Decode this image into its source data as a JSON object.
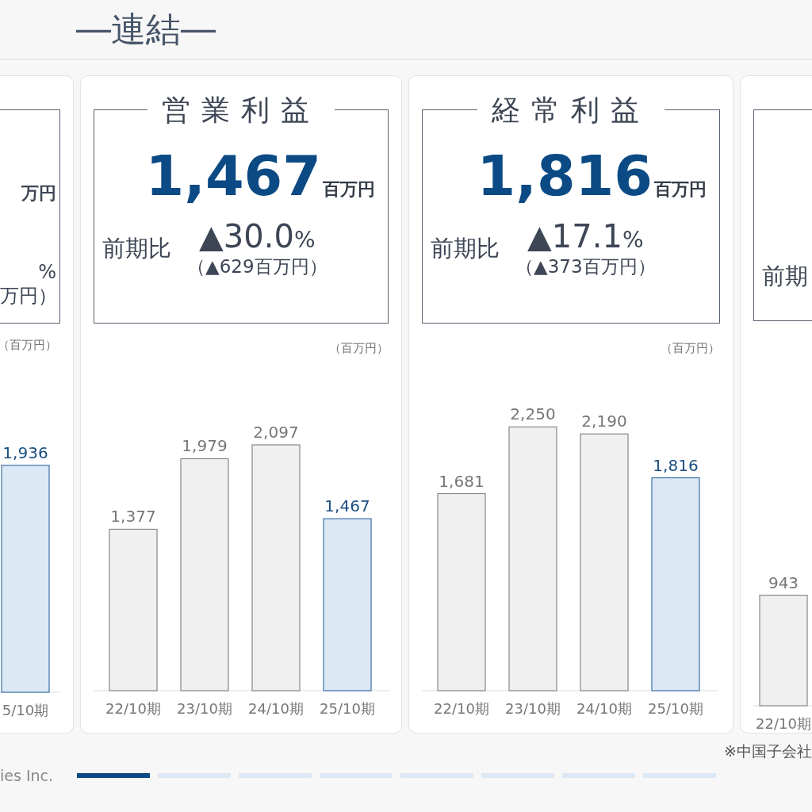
{
  "header": {
    "title": "―連結―"
  },
  "cards": [
    {
      "kind": "partial_left",
      "unit_fragment": "万円",
      "rate_fragment": "%",
      "amount_fragment": "万円）",
      "chart_unit": "（百万円）",
      "bars": [
        {
          "current": true
        }
      ],
      "chart_data": {
        "type": "bar",
        "categories": [
          "5/10期"
        ],
        "values": [
          1936
        ],
        "value_labels": [
          "1,936"
        ]
      }
    },
    {
      "kind": "full",
      "title": "営業利益",
      "value": "1,467",
      "unit": "百万円",
      "change_label": "前期比",
      "change_rate": "▲30.0",
      "change_rate_unit": "%",
      "change_amount": "（▲629百万円）",
      "chart_unit": "（百万円）",
      "bars": [
        {
          "current": false
        },
        {
          "current": false
        },
        {
          "current": false
        },
        {
          "current": true
        }
      ],
      "chart_data": {
        "type": "bar",
        "categories": [
          "22/10期",
          "23/10期",
          "24/10期",
          "25/10期"
        ],
        "values": [
          1377,
          1979,
          2097,
          1467
        ],
        "value_labels": [
          "1,377",
          "1,979",
          "2,097",
          "1,467"
        ]
      }
    },
    {
      "kind": "full",
      "title": "経常利益",
      "value": "1,816",
      "unit": "百万円",
      "change_label": "前期比",
      "change_rate": "▲17.1",
      "change_rate_unit": "%",
      "change_amount": "（▲373百万円）",
      "chart_unit": "（百万円）",
      "bars": [
        {
          "current": false
        },
        {
          "current": false
        },
        {
          "current": false
        },
        {
          "current": true
        }
      ],
      "chart_data": {
        "type": "bar",
        "categories": [
          "22/10期",
          "23/10期",
          "24/10期",
          "25/10期"
        ],
        "values": [
          1681,
          2250,
          2190,
          1816
        ],
        "value_labels": [
          "1,681",
          "2,250",
          "2,190",
          "1,816"
        ]
      }
    },
    {
      "kind": "partial_right",
      "change_label": "前期",
      "bars": [
        {
          "current": false
        }
      ],
      "chart_data": {
        "type": "bar",
        "categories": [
          "22/10期"
        ],
        "values": [
          943
        ],
        "value_labels": [
          "943"
        ]
      }
    }
  ],
  "footer": {
    "note": "※中国子会社",
    "company": "ies Inc.",
    "pages": [
      {
        "selected": true
      },
      {
        "selected": false
      },
      {
        "selected": false
      },
      {
        "selected": false
      },
      {
        "selected": false
      },
      {
        "selected": false
      },
      {
        "selected": false
      },
      {
        "selected": false
      }
    ]
  }
}
